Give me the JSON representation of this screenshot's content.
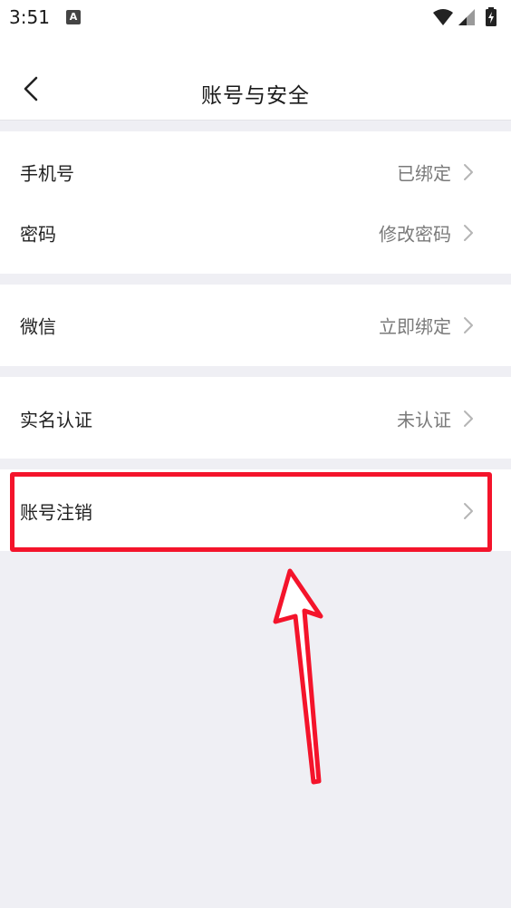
{
  "status_bar": {
    "time": "3:51",
    "notification_icon": "A",
    "icons": [
      "wifi-icon",
      "cellular-signal-icon",
      "battery-charging-icon"
    ]
  },
  "header": {
    "title": "账号与安全",
    "back_icon": "chevron-left-icon"
  },
  "sections": {
    "phone": {
      "label": "手机号",
      "value": "已绑定"
    },
    "password": {
      "label": "密码",
      "value": "修改密码"
    },
    "wechat": {
      "label": "微信",
      "value": "立即绑定"
    },
    "real_name": {
      "label": "实名认证",
      "value": "未认证"
    },
    "cancel_account": {
      "label": "账号注销",
      "value": ""
    }
  },
  "annotation": {
    "highlight_color": "#f4142b",
    "highlighted_item": "账号注销"
  },
  "colors": {
    "background": "#efeff4",
    "card": "#ffffff",
    "value_text": "#7a7a7a",
    "chevron": "#b5b5b5"
  }
}
